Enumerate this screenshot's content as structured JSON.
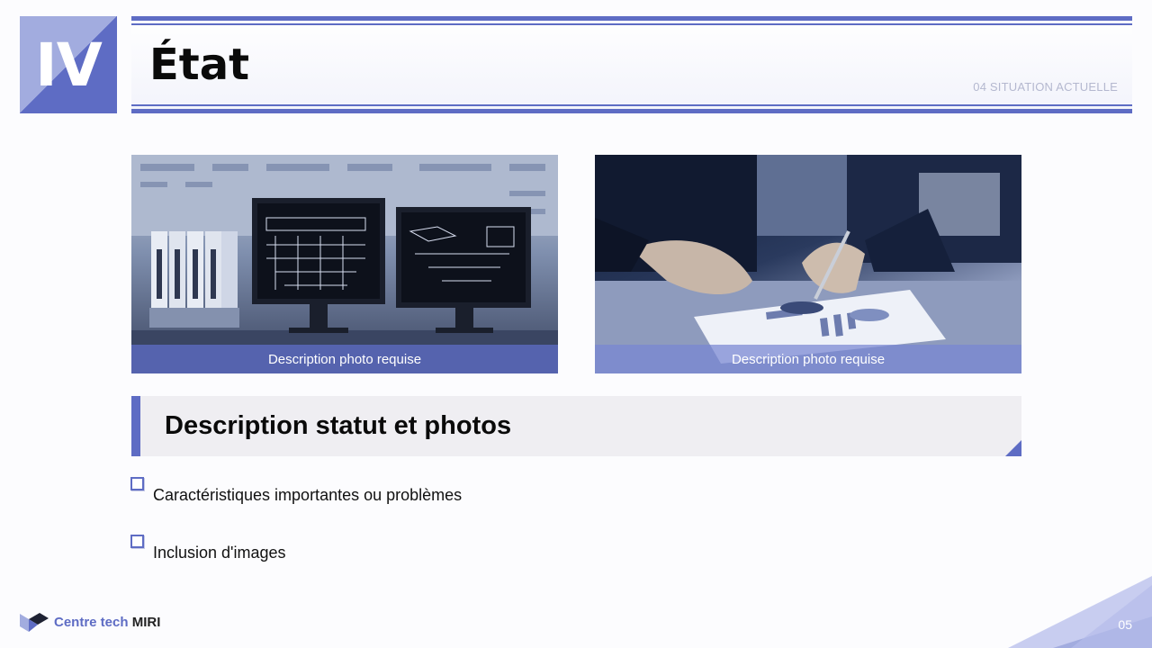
{
  "section": {
    "numeral": "IV"
  },
  "header": {
    "title": "État",
    "section_label": "04 SITUATION ACTUELLE"
  },
  "photos": [
    {
      "caption": "Description photo requise"
    },
    {
      "caption": "Description photo requise"
    }
  ],
  "content": {
    "heading": "Description statut et photos",
    "bullets": [
      "Caractéristiques importantes ou problèmes",
      "Inclusion d'images"
    ]
  },
  "footer": {
    "brand_part1": "Centre tech",
    "brand_part2": "MIRI",
    "page_number": "05"
  },
  "colors": {
    "accent": "#5e6cc4",
    "accent_light": "#a2acdf",
    "heading_bg": "#efeef2"
  }
}
